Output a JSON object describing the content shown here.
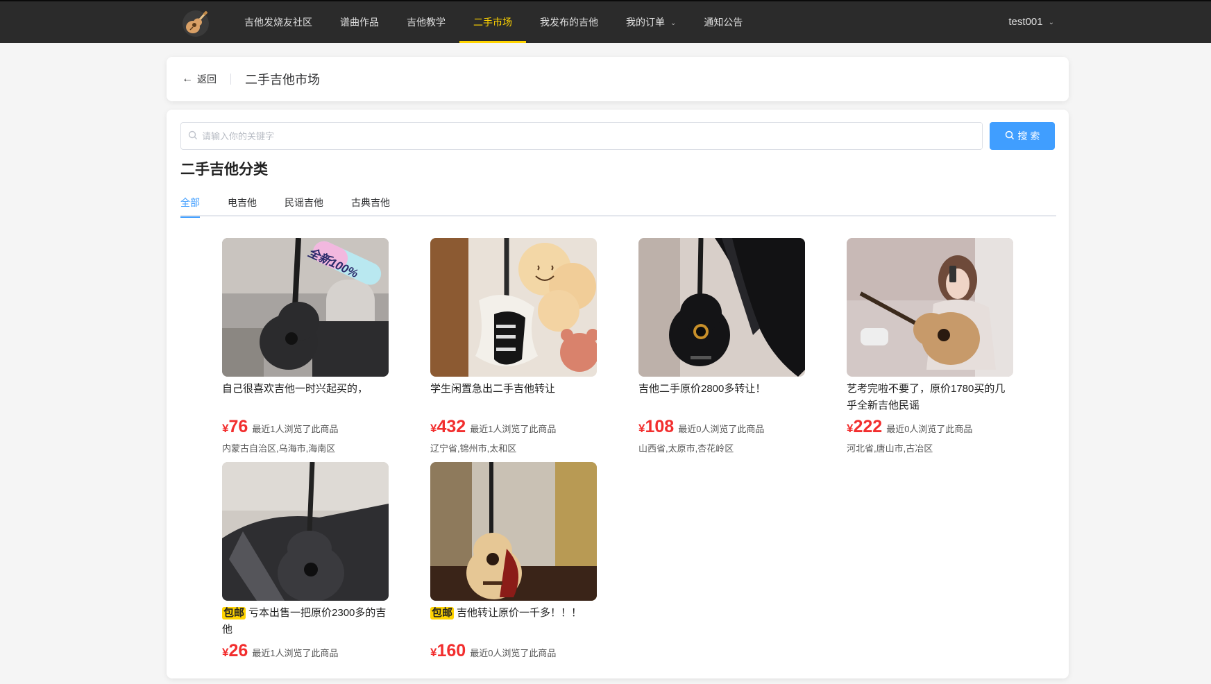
{
  "nav": {
    "items": [
      {
        "label": "吉他发烧友社区",
        "active": false
      },
      {
        "label": "谱曲作品",
        "active": false
      },
      {
        "label": "吉他教学",
        "active": false
      },
      {
        "label": "二手市场",
        "active": true
      },
      {
        "label": "我发布的吉他",
        "active": false
      },
      {
        "label": "我的订单",
        "active": false
      },
      {
        "label": "通知公告",
        "active": false
      }
    ],
    "user": "test001",
    "accent": "#ffd400",
    "logo_icon": "guitar-icon"
  },
  "header": {
    "back_label": "返回",
    "title": "二手吉他市场"
  },
  "search": {
    "placeholder": "请输入你的关键字",
    "value": "",
    "button_label": "搜 索",
    "button_color": "#409eff"
  },
  "category": {
    "title": "二手吉他分类",
    "tabs": [
      {
        "label": "全部",
        "active": true
      },
      {
        "label": "电吉他",
        "active": false
      },
      {
        "label": "民谣吉他",
        "active": false
      },
      {
        "label": "古典吉他",
        "active": false
      }
    ]
  },
  "products": [
    {
      "badge": "",
      "title": "自己很喜欢吉他一时兴起买的，",
      "yen": "¥",
      "price": "76",
      "views": "最近1人浏览了此商品",
      "location": "内蒙古自治区,乌海市,海南区",
      "sticker": "全新100%"
    },
    {
      "badge": "",
      "title": "学生闲置急出二手吉他转让",
      "yen": "¥",
      "price": "432",
      "views": "最近1人浏览了此商品",
      "location": "辽宁省,锦州市,太和区",
      "sticker": ""
    },
    {
      "badge": "",
      "title": "吉他二手原价2800多转让！",
      "yen": "¥",
      "price": "108",
      "views": "最近0人浏览了此商品",
      "location": "山西省,太原市,杏花岭区",
      "sticker": ""
    },
    {
      "badge": "",
      "title": "艺考完啦不要了，原价1780买的几乎全新吉他民谣",
      "yen": "¥",
      "price": "222",
      "views": "最近0人浏览了此商品",
      "location": "河北省,唐山市,古冶区",
      "sticker": ""
    },
    {
      "badge": "包邮",
      "title": "亏本出售一把原价2300多的吉他",
      "yen": "¥",
      "price": "26",
      "views": "最近1人浏览了此商品",
      "location": "",
      "sticker": ""
    },
    {
      "badge": "包邮",
      "title": "吉他转让原价一千多！！！",
      "yen": "¥",
      "price": "160",
      "views": "最近0人浏览了此商品",
      "location": "",
      "sticker": ""
    }
  ],
  "colors": {
    "price": "#f22e2e",
    "tab_active": "#409eff"
  }
}
